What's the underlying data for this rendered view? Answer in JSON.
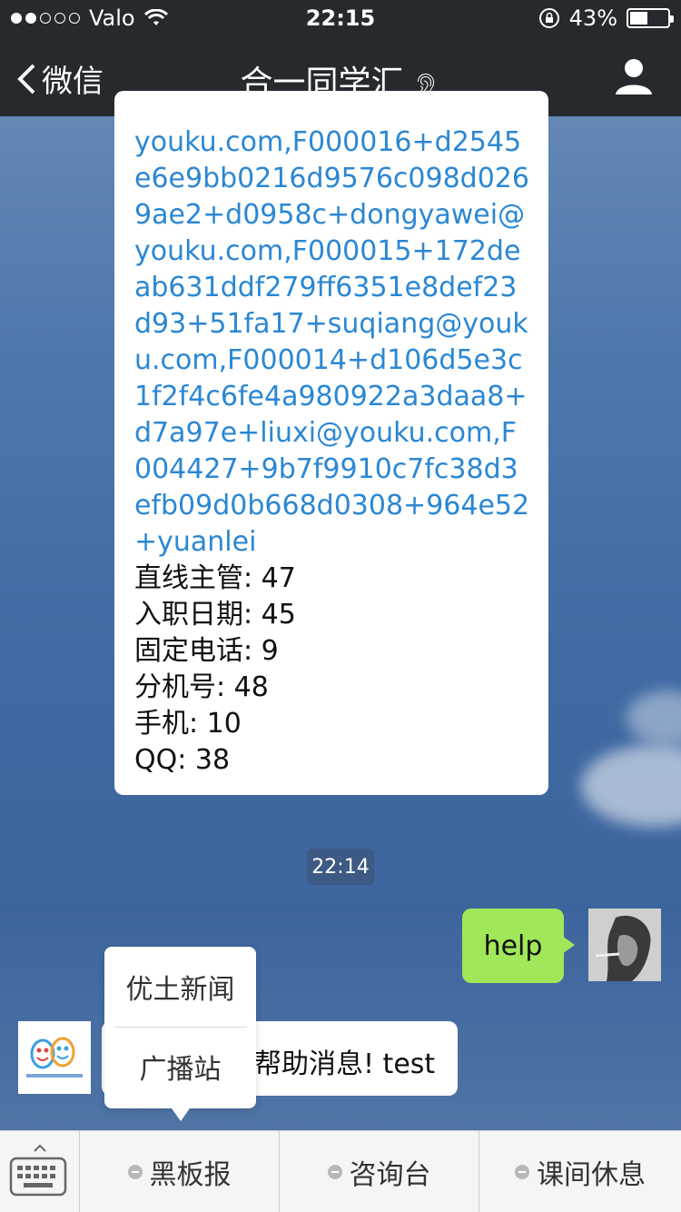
{
  "status_bar": {
    "carrier": "Valo",
    "time": "22:15",
    "battery": "43%"
  },
  "nav": {
    "back_label": "微信",
    "title": "合一同学汇"
  },
  "messages": {
    "long_message": {
      "link_text": "youku.com,F000016+d2545e6e9bb0216d9576c098d0269ae2+d0958c+dongyawei@youku.com,F000015+172deab631ddf279ff6351e8def23d93+51fa17+suqiang@youku.com,F000014+d106d5e3c1f2f4c6fe4a980922a3daa8+d7a97e+liuxi@youku.com,F004427+9b7f9910c7fc38d3efb09d0b668d0308+964e52+yuanlei",
      "fields": [
        {
          "label": "直线主管:",
          "value": "47"
        },
        {
          "label": "入职日期:",
          "value": "45"
        },
        {
          "label": "固定电话:",
          "value": "9"
        },
        {
          "label": "分机号:",
          "value": "48"
        },
        {
          "label": "手机:",
          "value": "10"
        },
        {
          "label": "QQ:",
          "value": "38"
        }
      ]
    },
    "timestamp": "22:14",
    "outgoing_text": "help",
    "reply_text": "帮助消息! test"
  },
  "popup_menu": {
    "items": [
      "优土新闻",
      "广播站"
    ]
  },
  "bottom_menu": {
    "tabs": [
      "黑板报",
      "咨询台",
      "课间休息"
    ]
  },
  "colors": {
    "link": "#2b87d3",
    "out_bubble": "#a0e75a",
    "nav_bg": "#26292e"
  }
}
